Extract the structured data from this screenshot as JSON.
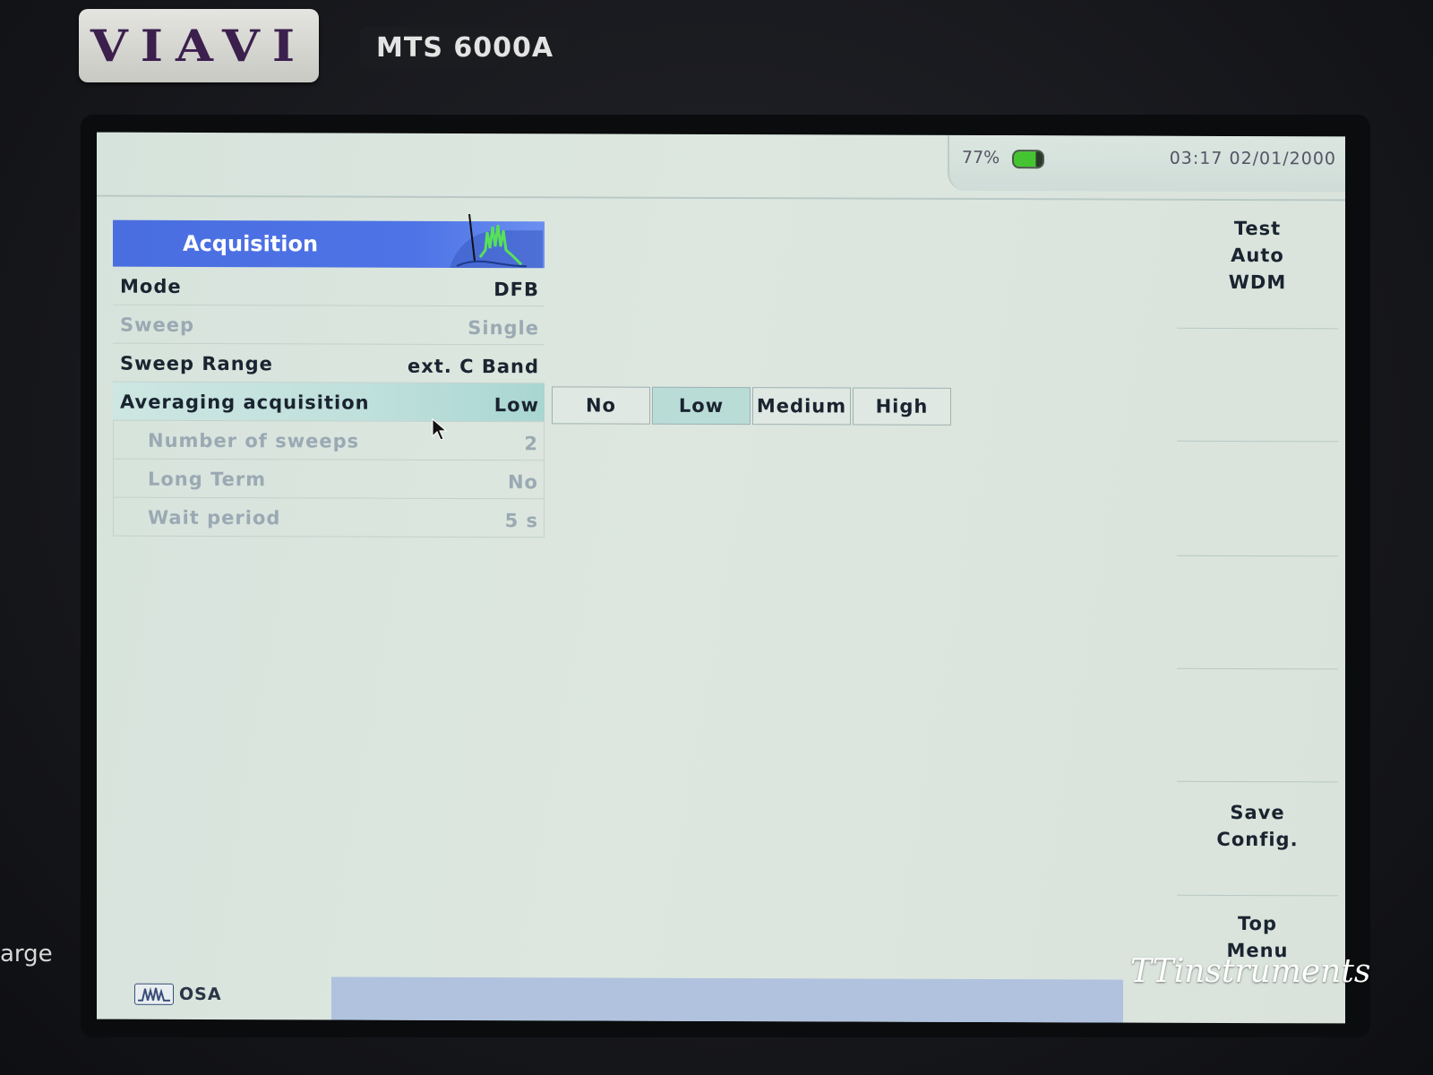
{
  "device": {
    "brand": "VIAVI",
    "model": "MTS 6000A",
    "side_label": "arge"
  },
  "status": {
    "battery_percent": "77%",
    "battery_level": 0.77,
    "datetime": "03:17  02/01/2000"
  },
  "panel": {
    "title": "Acquisition",
    "rows": [
      {
        "label": "Mode",
        "value": "DFB",
        "state": "enabled"
      },
      {
        "label": "Sweep",
        "value": "Single",
        "state": "disabled"
      },
      {
        "label": "Sweep Range",
        "value": "ext. C Band",
        "state": "enabled"
      },
      {
        "label": "Averaging acquisition",
        "value": "Low",
        "state": "selected"
      },
      {
        "label": "Number of sweeps",
        "value": "2",
        "state": "disabled"
      },
      {
        "label": "Long Term",
        "value": "No",
        "state": "disabled"
      },
      {
        "label": "Wait period",
        "value": "5 s",
        "state": "disabled"
      }
    ]
  },
  "options": {
    "items": [
      "No",
      "Low",
      "Medium",
      "High"
    ],
    "selected": "Low"
  },
  "softkeys": {
    "test_line1": "Test",
    "test_line2": "Auto",
    "test_line3": "WDM",
    "save_line1": "Save",
    "save_line2": "Config.",
    "top_line1": "Top",
    "top_line2": "Menu"
  },
  "bottom": {
    "tab_label": "OSA"
  },
  "watermark": "TTinstruments",
  "colors": {
    "header_blue": "#4a6ee0",
    "selected_row": "#bfe0dc",
    "screen_bg": "#d9e4dd",
    "progress_bar": "#b0c2de"
  }
}
